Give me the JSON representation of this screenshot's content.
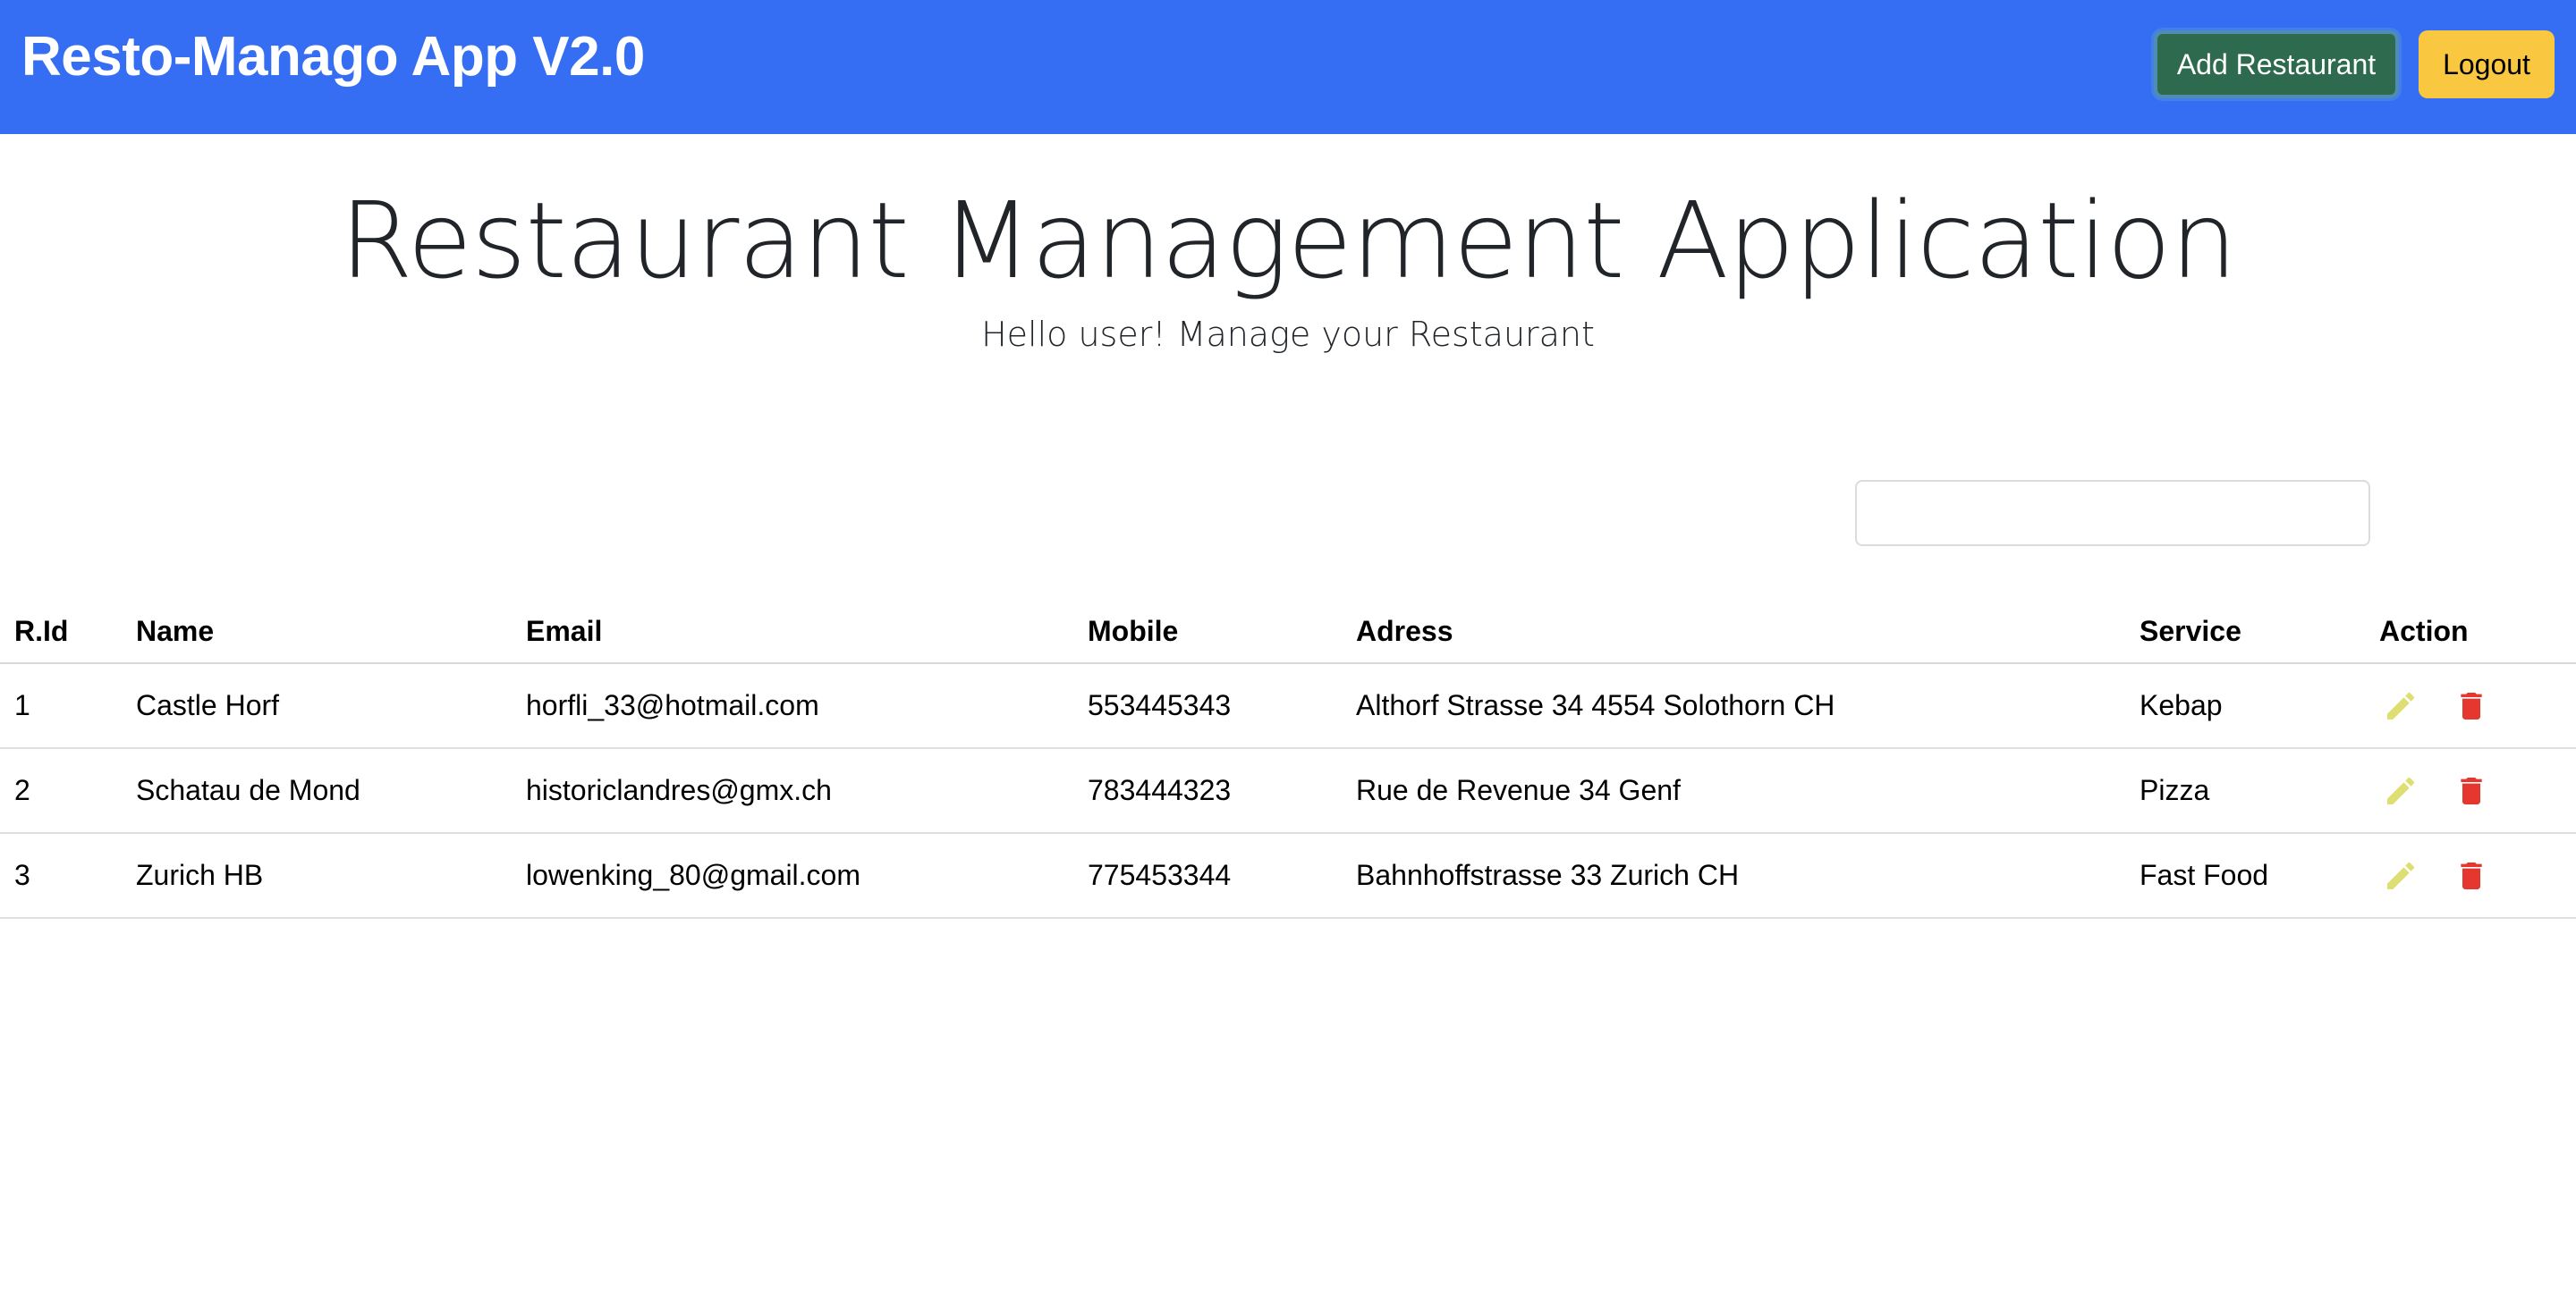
{
  "navbar": {
    "brand": "Resto-Manago App V2.0",
    "add_label": "Add Restaurant",
    "logout_label": "Logout"
  },
  "hero": {
    "title": "Restaurant Management Application",
    "subtitle": "Hello user! Manage your Restaurant"
  },
  "search": {
    "value": "",
    "placeholder": ""
  },
  "table": {
    "headers": [
      "R.Id",
      "Name",
      "Email",
      "Mobile",
      "Adress",
      "Service",
      "Action"
    ],
    "rows": [
      {
        "id": "1",
        "name": "Castle Horf",
        "email": "horfli_33@hotmail.com",
        "mobile": "553445343",
        "adress": "Althorf Strasse 34 4554 Solothorn CH",
        "service": "Kebap"
      },
      {
        "id": "2",
        "name": "Schatau de Mond",
        "email": "historiclandres@gmx.ch",
        "mobile": "783444323",
        "adress": "Rue de Revenue 34 Genf",
        "service": "Pizza"
      },
      {
        "id": "3",
        "name": "Zurich HB",
        "email": "lowenking_80@gmail.com",
        "mobile": "775453344",
        "adress": "Bahnhoffstrasse 33 Zurich CH",
        "service": "Fast Food"
      }
    ]
  },
  "colors": {
    "navbar": "#356df3",
    "add_button": "#2e6b4e",
    "logout_button": "#f9c740",
    "edit_icon": "#dede72",
    "delete_icon": "#e5372d"
  },
  "icons": {
    "edit": "pencil-icon",
    "delete": "trash-icon"
  }
}
